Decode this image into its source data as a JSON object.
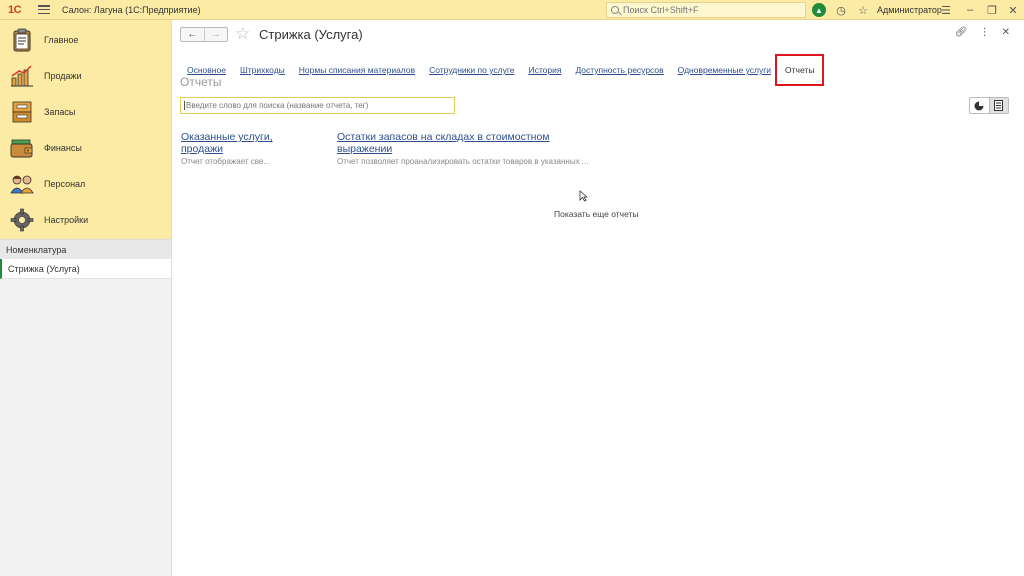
{
  "topbar": {
    "logo": "1С",
    "title": "Салон: Лагуна  (1С:Предприятие)",
    "search_placeholder": "Поиск Ctrl+Shift+F",
    "user": "Администратор",
    "brand_color": "#fbeba4"
  },
  "sidebar": {
    "menu": [
      {
        "label": "Главное",
        "icon": "clipboard-icon"
      },
      {
        "label": "Продажи",
        "icon": "sales-chart-icon"
      },
      {
        "label": "Запасы",
        "icon": "stock-box-icon"
      },
      {
        "label": "Финансы",
        "icon": "wallet-icon"
      },
      {
        "label": "Персонал",
        "icon": "people-icon"
      },
      {
        "label": "Настройки",
        "icon": "gear-icon"
      }
    ],
    "section": "Номенклатура",
    "open_window": "Стрижка (Услуга)"
  },
  "form": {
    "title": "Стрижка (Услуга)",
    "tabs": [
      {
        "label": "Основное"
      },
      {
        "label": "Штрихкоды"
      },
      {
        "label": "Нормы списания материалов"
      },
      {
        "label": "Сотрудники по услуге"
      },
      {
        "label": "История"
      },
      {
        "label": "Доступность ресурсов"
      },
      {
        "label": "Одновременные услуги"
      },
      {
        "label": "Отчеты"
      }
    ],
    "active_tab": "Отчеты",
    "section_title": "Отчеты",
    "search_placeholder": "Введите слово для поиска (название отчета, тег)",
    "reports": [
      {
        "name": "Оказанные услуги, продажи",
        "description": "Отчет отображает све..."
      },
      {
        "name": "Остатки запасов на складах в стоимостном выражении",
        "description": "Отчет позволяет проанализировать остатки товаров в указанных ..."
      }
    ],
    "more_link": "Показать еще отчеты",
    "highlight_color": "#e0141e"
  }
}
